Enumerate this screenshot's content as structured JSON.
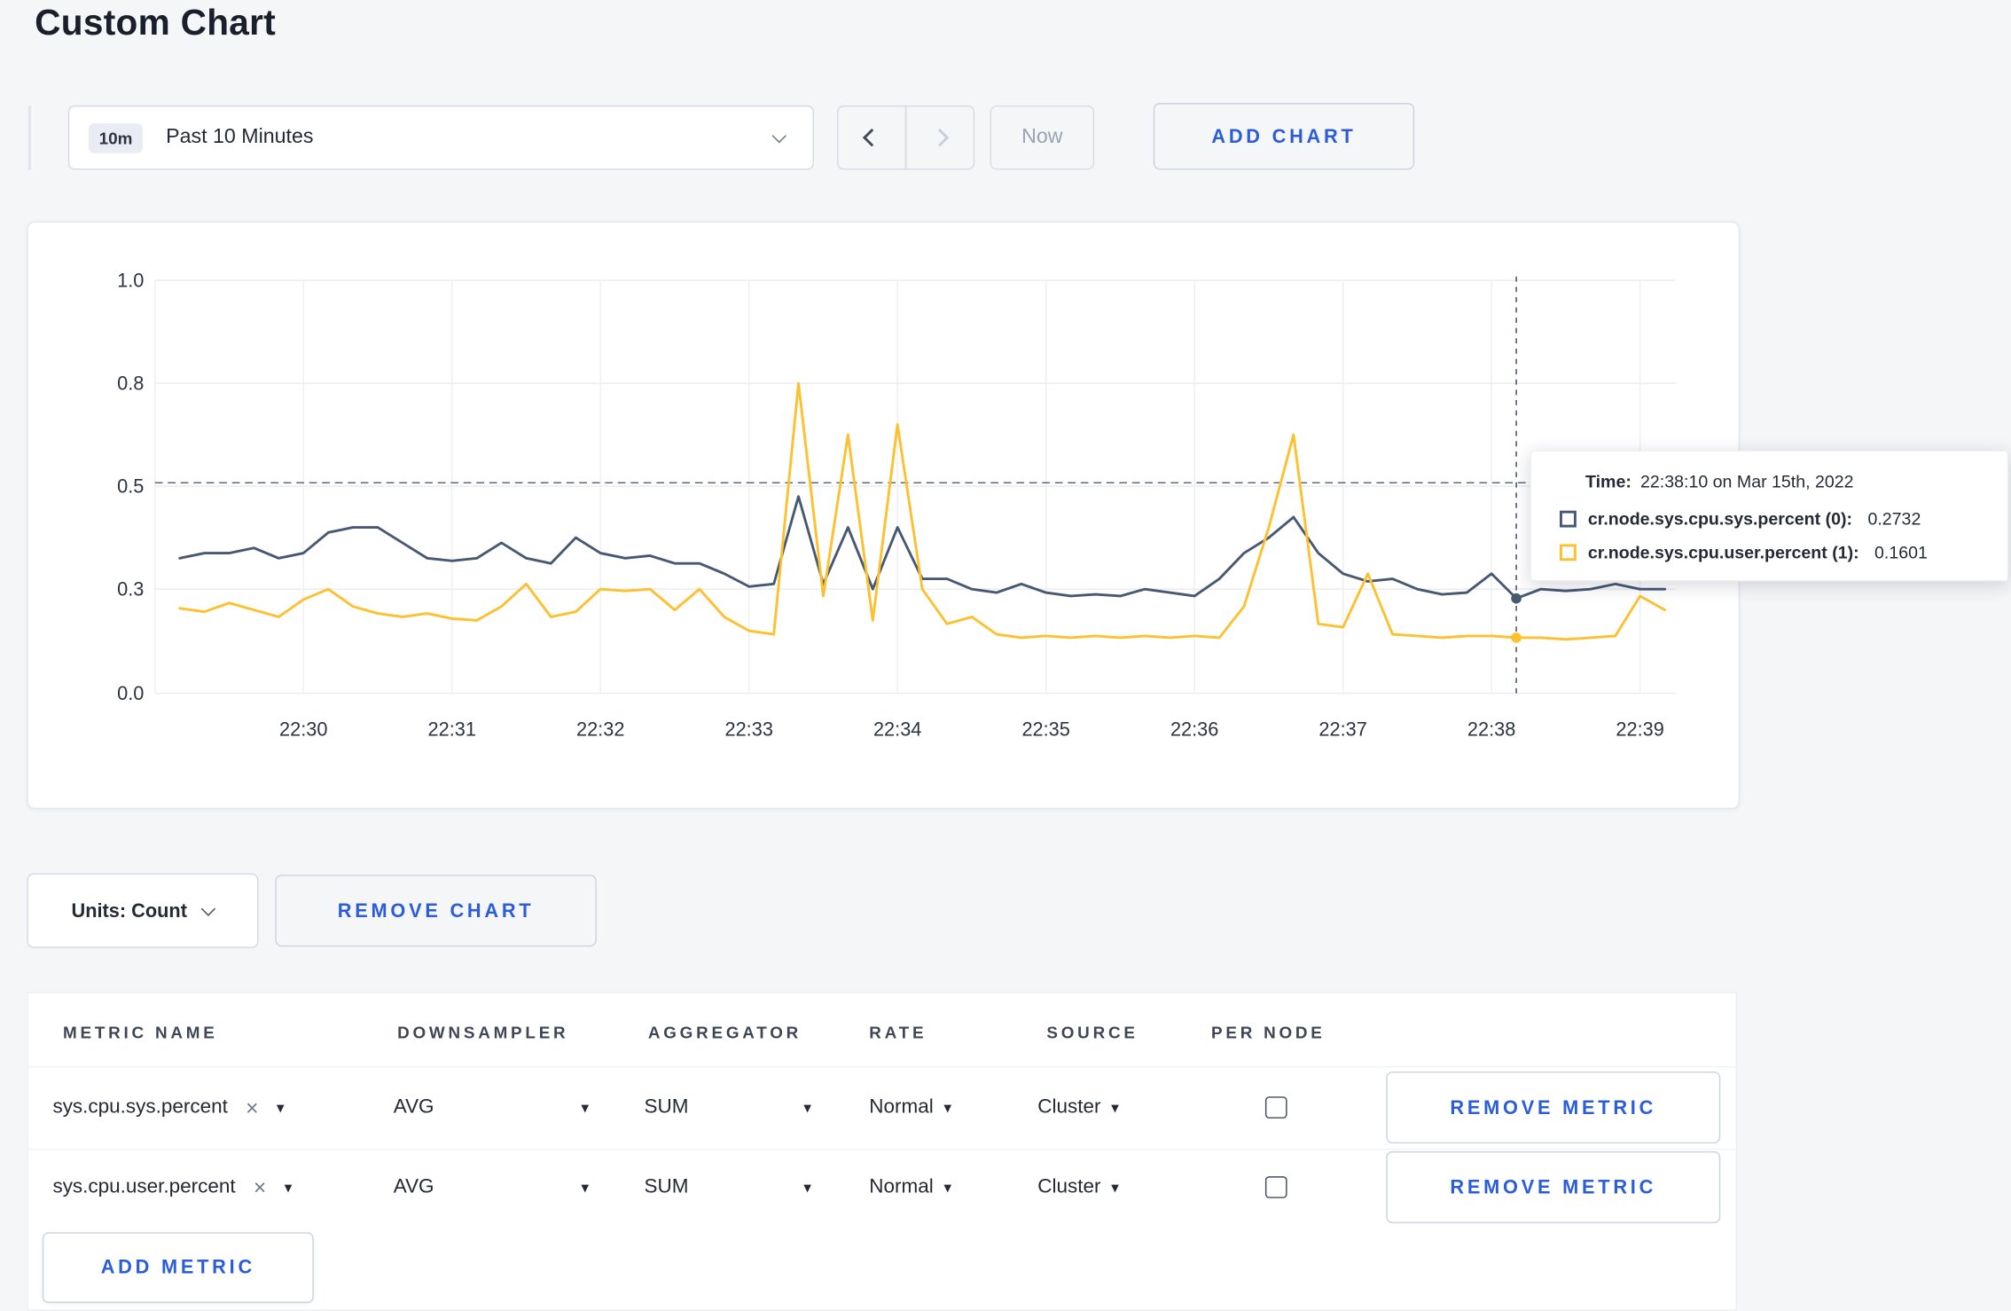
{
  "theme": {
    "accent": "#2b5dd9",
    "page_bg": "#f5f6f8",
    "card_bg": "#ffffff",
    "muted_text": "#9aa3b2",
    "grid_line": "#e9ecf1",
    "series_sys_color": "#475872",
    "series_user_color": "#fdc02e"
  },
  "page": {
    "title": "Custom Chart"
  },
  "toolbar": {
    "time_range": {
      "badge": "10m",
      "label": "Past 10 Minutes"
    },
    "now_label": "Now",
    "add_chart_label": "ADD CHART"
  },
  "chart_controls": {
    "units_label": "Units: Count",
    "remove_chart_label": "REMOVE CHART"
  },
  "tooltip": {
    "time_label": "Time:",
    "time_value": "22:38:10 on Mar 15th, 2022",
    "rows": [
      {
        "name": "cr.node.sys.cpu.sys.percent (0):",
        "value": "0.2732"
      },
      {
        "name": "cr.node.sys.cpu.user.percent (1):",
        "value": "0.1601"
      }
    ]
  },
  "chart_data": {
    "type": "line",
    "title": "",
    "xlabel": "",
    "ylabel": "",
    "x_ticks": [
      "22:30",
      "22:31",
      "22:32",
      "22:33",
      "22:34",
      "22:35",
      "22:36",
      "22:37",
      "22:38",
      "22:39"
    ],
    "x_start": "22:29:10",
    "x_interval_seconds": 10,
    "y_ticks": [
      1.0,
      0.8,
      0.5,
      0.3,
      0.0
    ],
    "ylim": [
      0,
      1
    ],
    "grid": true,
    "legend_position": "tooltip",
    "threshold_line": 0.51,
    "crosshair": {
      "index": 54,
      "time": "22:38:10 on Mar 15th, 2022",
      "values": [
        0.2732,
        0.1601
      ]
    },
    "series": [
      {
        "name": "cr.node.sys.cpu.sys.percent",
        "color": "#475872",
        "values": [
          0.36,
          0.37,
          0.37,
          0.38,
          0.36,
          0.37,
          0.41,
          0.42,
          0.42,
          0.39,
          0.36,
          0.355,
          0.36,
          0.39,
          0.36,
          0.35,
          0.4,
          0.37,
          0.36,
          0.365,
          0.35,
          0.35,
          0.33,
          0.305,
          0.31,
          0.48,
          0.31,
          0.42,
          0.3,
          0.42,
          0.32,
          0.32,
          0.3,
          0.29,
          0.31,
          0.29,
          0.28,
          0.285,
          0.28,
          0.3,
          0.29,
          0.28,
          0.32,
          0.37,
          0.4,
          0.44,
          0.37,
          0.33,
          0.315,
          0.32,
          0.3,
          0.285,
          0.29,
          0.33,
          0.2732,
          0.3,
          0.295,
          0.3,
          0.31,
          0.3,
          0.3
        ]
      },
      {
        "name": "cr.node.sys.cpu.user.percent",
        "color": "#fdc02e",
        "values": [
          0.245,
          0.235,
          0.26,
          0.24,
          0.22,
          0.27,
          0.3,
          0.25,
          0.23,
          0.22,
          0.23,
          0.215,
          0.21,
          0.25,
          0.31,
          0.22,
          0.235,
          0.3,
          0.295,
          0.3,
          0.24,
          0.3,
          0.22,
          0.18,
          0.17,
          0.8,
          0.28,
          0.65,
          0.21,
          0.68,
          0.3,
          0.2,
          0.22,
          0.17,
          0.16,
          0.165,
          0.16,
          0.165,
          0.16,
          0.165,
          0.16,
          0.165,
          0.16,
          0.25,
          0.42,
          0.65,
          0.2,
          0.19,
          0.33,
          0.17,
          0.165,
          0.16,
          0.165,
          0.165,
          0.1601,
          0.16,
          0.155,
          0.16,
          0.165,
          0.28,
          0.24
        ]
      }
    ]
  },
  "metrics_table": {
    "headers": [
      "METRIC NAME",
      "DOWNSAMPLER",
      "AGGREGATOR",
      "RATE",
      "SOURCE",
      "PER NODE"
    ],
    "rows": [
      {
        "metric": "sys.cpu.sys.percent",
        "downsampler": "AVG",
        "aggregator": "SUM",
        "rate": "Normal",
        "source": "Cluster",
        "per_node_checked": false,
        "remove_label": "REMOVE METRIC"
      },
      {
        "metric": "sys.cpu.user.percent",
        "downsampler": "AVG",
        "aggregator": "SUM",
        "rate": "Normal",
        "source": "Cluster",
        "per_node_checked": false,
        "remove_label": "REMOVE METRIC"
      }
    ],
    "add_metric_label": "ADD METRIC"
  },
  "icons": {
    "close": "×",
    "caret": "▾"
  }
}
